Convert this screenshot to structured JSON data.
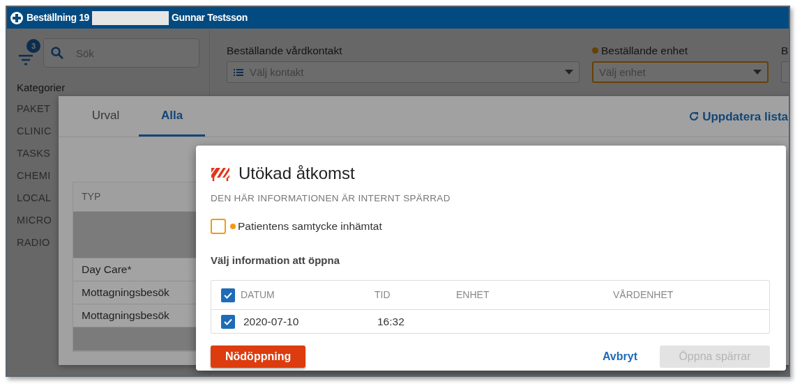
{
  "window": {
    "title_prefix": "Beställning 19",
    "title_name": "Gunnar Testsson"
  },
  "sidebar": {
    "filter_badge": "3",
    "search": {
      "placeholder": "Sök"
    },
    "heading": "Kategorier",
    "categories": [
      "PAKET",
      "CLINIC",
      "TASKS",
      "CHEMI",
      "LOCAL",
      "MICRO",
      "RADIO"
    ]
  },
  "form": {
    "fields": [
      {
        "label": "Beställande vårdkontakt",
        "placeholder": "Välj kontakt",
        "required": false
      },
      {
        "label": "Beställande enhet",
        "placeholder": "Välj enhet",
        "required": true
      },
      {
        "label": "B",
        "required": false
      }
    ]
  },
  "panel": {
    "tabs": [
      {
        "label": "Urval",
        "selected": false
      },
      {
        "label": "Alla",
        "selected": true
      }
    ],
    "refresh_link": "Uppdatera lista",
    "table": {
      "columns": [
        "TYP"
      ],
      "rows": [
        {
          "kind": "blank"
        },
        {
          "kind": "text",
          "text": "Day Care*"
        },
        {
          "kind": "text",
          "text": "Mottagningsbesök"
        },
        {
          "kind": "text",
          "text": "Mottagningsbesök"
        },
        {
          "kind": "blank"
        }
      ]
    }
  },
  "dialog": {
    "title": "Utökad åtkomst",
    "subtitle": "DEN HÄR INFORMATIONEN ÄR INTERNT SPÄRRAD",
    "consent": {
      "label": "Patientens samtycke inhämtat",
      "checked": false,
      "required": true
    },
    "section_title": "Välj information att öppna",
    "table": {
      "all_checked": true,
      "columns": [
        "DATUM",
        "TID",
        "ENHET",
        "VÅRDENHET"
      ],
      "rows": [
        {
          "checked": true,
          "cells": [
            "2020-07-10",
            "16:32"
          ]
        }
      ]
    },
    "buttons": {
      "emergency": "Nödöppning",
      "cancel": "Avbryt",
      "confirm": {
        "label": "Öppna spärrar",
        "disabled": true
      }
    }
  }
}
